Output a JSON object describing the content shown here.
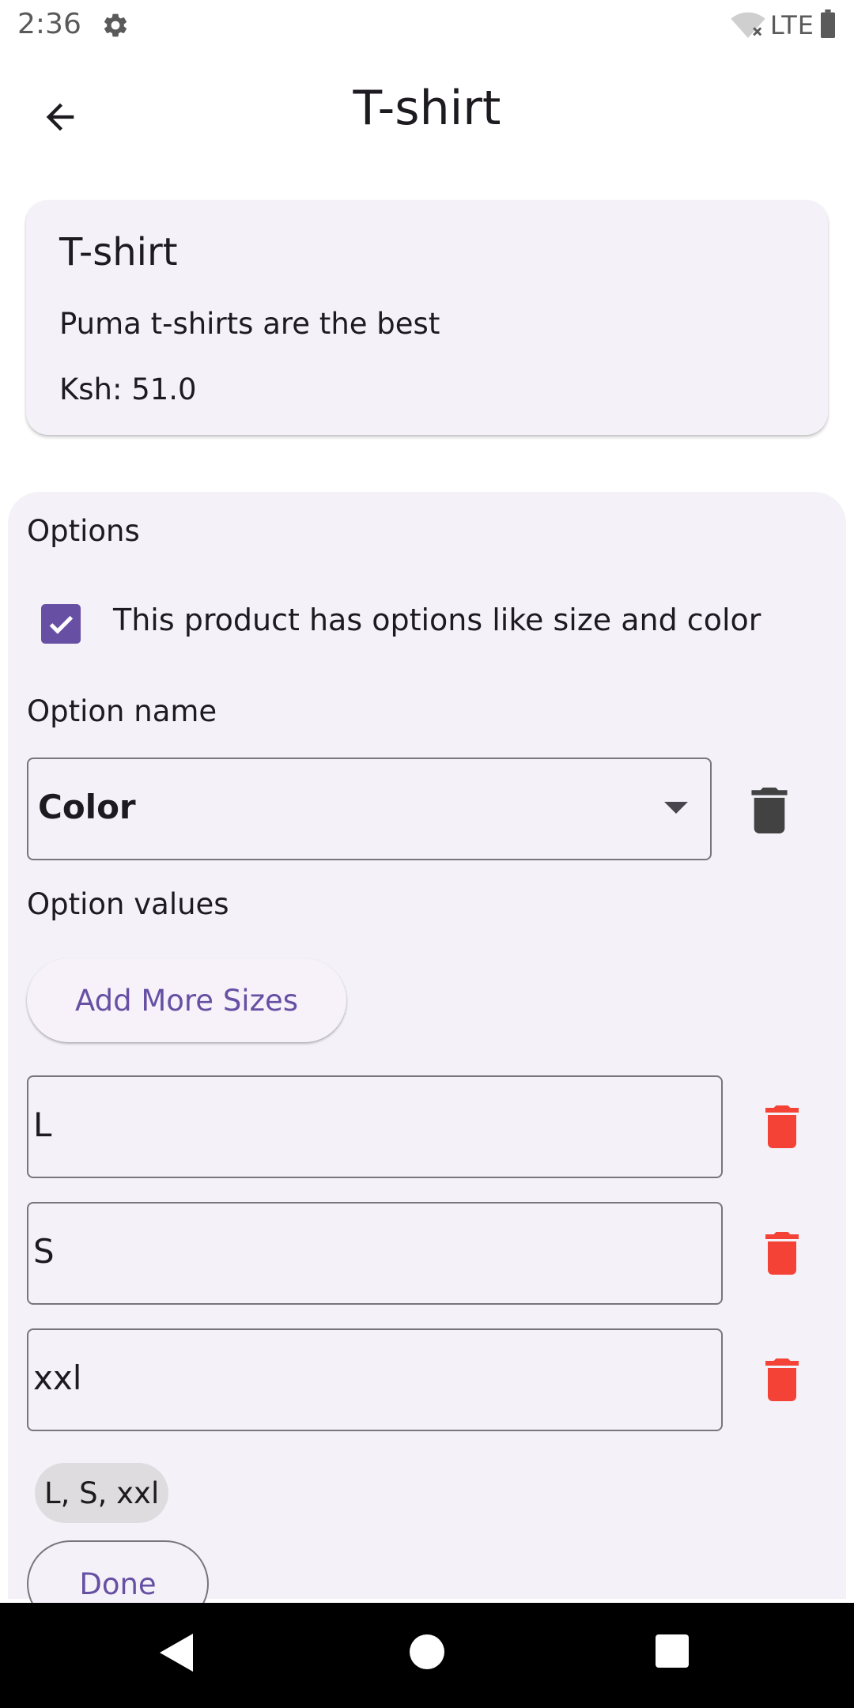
{
  "status_bar": {
    "time": "2:36",
    "network": "LTE"
  },
  "app_bar": {
    "title": "T-shirt"
  },
  "product": {
    "name": "T-shirt",
    "description": "Puma t-shirts are the best",
    "price": "Ksh: 51.0"
  },
  "options": {
    "heading": "Options",
    "checkbox_label": "This product has options like size and color",
    "checkbox_checked": true,
    "option_name_label": "Option name",
    "option_name_value": "Color",
    "option_values_label": "Option values",
    "add_button_label": "Add More Sizes",
    "values": [
      "L",
      "S",
      "xxl"
    ],
    "summary_chip": "L, S, xxl",
    "done_label": "Done"
  },
  "colors": {
    "accent": "#6750a4",
    "delete_red": "#f44336",
    "delete_dark": "#424242",
    "surface": "#f4f2f8"
  }
}
